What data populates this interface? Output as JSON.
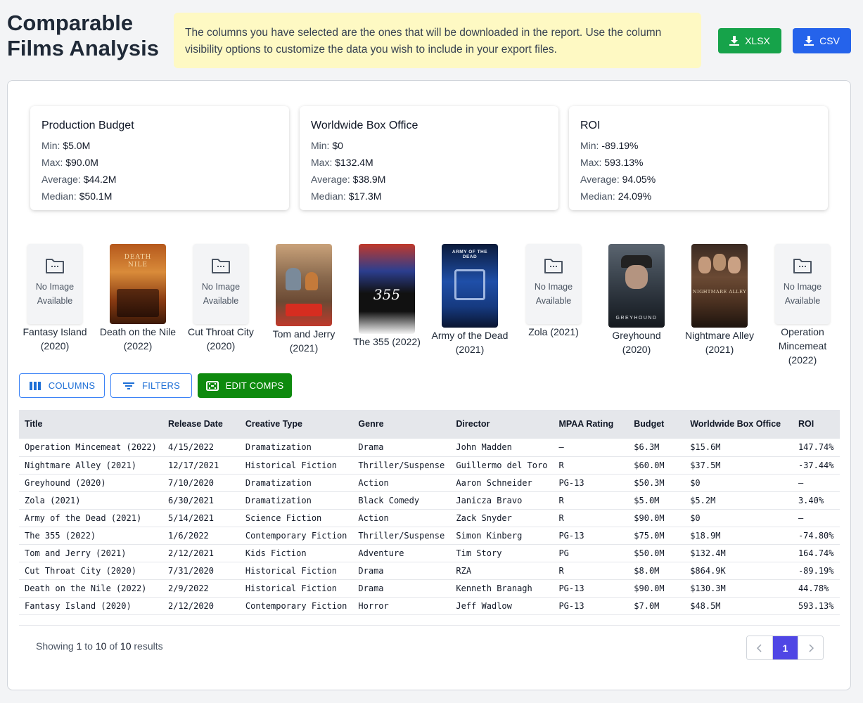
{
  "header": {
    "title": "Comparable Films Analysis",
    "notice": "The columns you have selected are the ones that will be downloaded in the report. Use the column visibility options to customize the data you wish to include in your export files.",
    "xlsx_label": "XLSX",
    "csv_label": "CSV"
  },
  "stats": [
    {
      "title": "Production Budget",
      "min_label": "Min:",
      "min": "$5.0M",
      "max_label": "Max:",
      "max": "$90.0M",
      "avg_label": "Average:",
      "avg": "$44.2M",
      "median_label": "Median:",
      "median": "$50.1M"
    },
    {
      "title": "Worldwide Box Office",
      "min_label": "Min:",
      "min": "$0",
      "max_label": "Max:",
      "max": "$132.4M",
      "avg_label": "Average:",
      "avg": "$38.9M",
      "median_label": "Median:",
      "median": "$17.3M"
    },
    {
      "title": "ROI",
      "min_label": "Min:",
      "min": "-89.19%",
      "max_label": "Max:",
      "max": "593.13%",
      "avg_label": "Average:",
      "avg": "94.05%",
      "median_label": "Median:",
      "median": "24.09%"
    }
  ],
  "no_image_text": [
    "No Image",
    "Available"
  ],
  "posters": [
    {
      "caption": "Fantasy Island (2020)",
      "has_image": false
    },
    {
      "caption": "Death on the Nile (2022)",
      "has_image": true
    },
    {
      "caption": "Cut Throat City (2020)",
      "has_image": false
    },
    {
      "caption": "Tom and Jerry (2021)",
      "has_image": true
    },
    {
      "caption": "The 355 (2022)",
      "has_image": true,
      "poster_text": "355"
    },
    {
      "caption": "Army of the Dead (2021)",
      "has_image": true,
      "poster_text": "ARMY OF THE DEAD"
    },
    {
      "caption": "Zola (2021)",
      "has_image": false
    },
    {
      "caption": "Greyhound (2020)",
      "has_image": true,
      "poster_text": "GREYHOUND"
    },
    {
      "caption": "Nightmare Alley (2021)",
      "has_image": true,
      "poster_text": "NIGHTMARE ALLEY"
    },
    {
      "caption": "Operation Mincemeat (2022)",
      "has_image": false
    }
  ],
  "toolbar": {
    "columns_label": "COLUMNS",
    "filters_label": "FILTERS",
    "edit_label": "EDIT COMPS"
  },
  "table": {
    "headers": [
      "Title",
      "Release Date",
      "Creative Type",
      "Genre",
      "Director",
      "MPAA Rating",
      "Budget",
      "Worldwide Box Office",
      "ROI"
    ],
    "rows": [
      [
        "Operation Mincemeat (2022)",
        "4/15/2022",
        "Dramatization",
        "Drama",
        "John Madden",
        "–",
        "$6.3M",
        "$15.6M",
        "147.74%"
      ],
      [
        "Nightmare Alley (2021)",
        "12/17/2021",
        "Historical Fiction",
        "Thriller/Suspense",
        "Guillermo del Toro",
        "R",
        "$60.0M",
        "$37.5M",
        "-37.44%"
      ],
      [
        "Greyhound (2020)",
        "7/10/2020",
        "Dramatization",
        "Action",
        "Aaron Schneider",
        "PG-13",
        "$50.3M",
        "$0",
        "–"
      ],
      [
        "Zola (2021)",
        "6/30/2021",
        "Dramatization",
        "Black Comedy",
        "Janicza Bravo",
        "R",
        "$5.0M",
        "$5.2M",
        "3.40%"
      ],
      [
        "Army of the Dead (2021)",
        "5/14/2021",
        "Science Fiction",
        "Action",
        "Zack Snyder",
        "R",
        "$90.0M",
        "$0",
        "–"
      ],
      [
        "The 355 (2022)",
        "1/6/2022",
        "Contemporary Fiction",
        "Thriller/Suspense",
        "Simon Kinberg",
        "PG-13",
        "$75.0M",
        "$18.9M",
        "-74.80%"
      ],
      [
        "Tom and Jerry (2021)",
        "2/12/2021",
        "Kids Fiction",
        "Adventure",
        "Tim Story",
        "PG",
        "$50.0M",
        "$132.4M",
        "164.74%"
      ],
      [
        "Cut Throat City (2020)",
        "7/31/2020",
        "Historical Fiction",
        "Drama",
        "RZA",
        "R",
        "$8.0M",
        "$864.9K",
        "-89.19%"
      ],
      [
        "Death on the Nile (2022)",
        "2/9/2022",
        "Historical Fiction",
        "Drama",
        "Kenneth Branagh",
        "PG-13",
        "$90.0M",
        "$130.3M",
        "44.78%"
      ],
      [
        "Fantasy Island (2020)",
        "2/12/2020",
        "Contemporary Fiction",
        "Horror",
        "Jeff Wadlow",
        "PG-13",
        "$7.0M",
        "$48.5M",
        "593.13%"
      ]
    ]
  },
  "pagination": {
    "showing": "Showing",
    "from": "1",
    "to_word": "to",
    "to": "10",
    "of_word": "of",
    "total": "10",
    "results_word": "results",
    "current_page": "1",
    "prev_icon": "chevron-left-icon",
    "next_icon": "chevron-right-icon"
  },
  "colors": {
    "xlsx": "#16a34a",
    "csv": "#2563eb",
    "edit": "#0e8a0e",
    "notice_bg": "#fef9c3",
    "page_active": "#4f46e5"
  }
}
